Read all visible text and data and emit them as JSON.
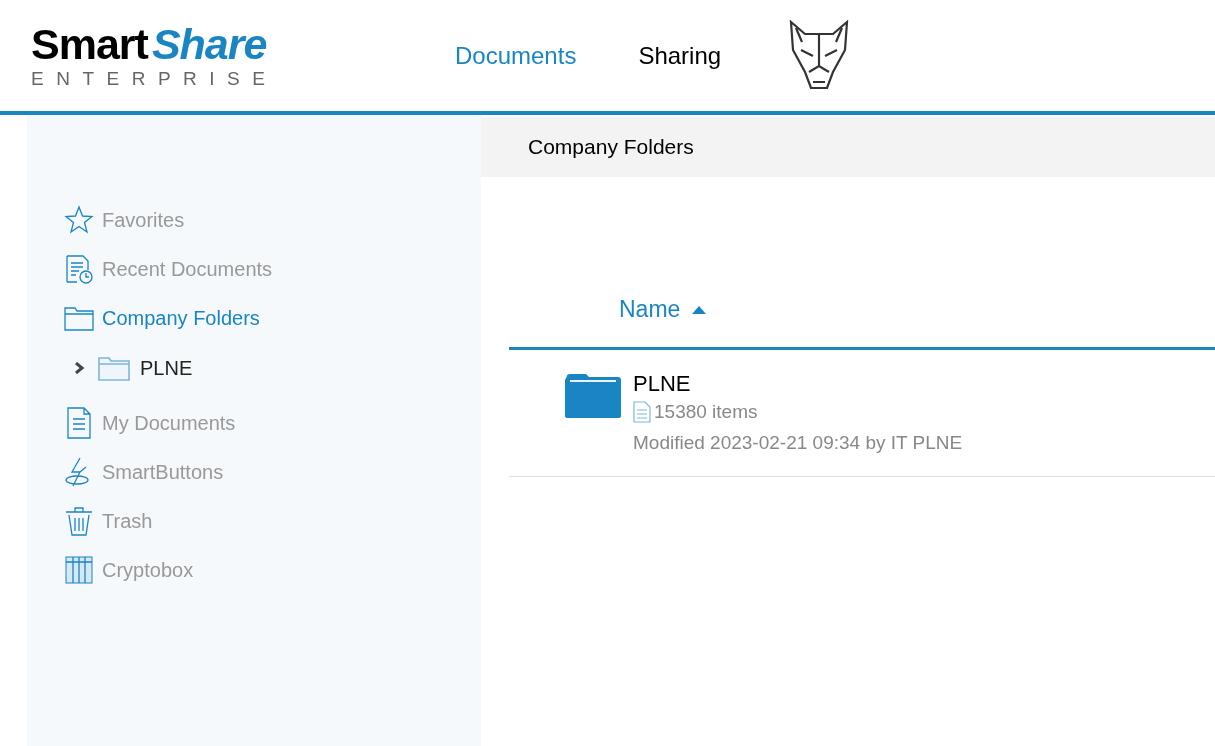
{
  "logo": {
    "word_1": "Smart",
    "word_2": "Share",
    "subtitle": "ENTERPRISE"
  },
  "nav": [
    {
      "label": "Documents",
      "selected": true
    },
    {
      "label": "Sharing",
      "selected": false
    }
  ],
  "sidebar": {
    "items": [
      {
        "kind": "star",
        "label": "Favorites",
        "selected": false
      },
      {
        "kind": "recent",
        "label": "Recent Documents",
        "selected": false
      },
      {
        "kind": "folder",
        "label": "Company Folders",
        "selected": true,
        "children": [
          {
            "label": "PLNE",
            "expanded": false
          }
        ]
      },
      {
        "kind": "document",
        "label": "My Documents",
        "selected": false
      },
      {
        "kind": "smartbuttons",
        "label": "SmartButtons",
        "selected": false
      },
      {
        "kind": "trash",
        "label": "Trash",
        "selected": false
      },
      {
        "kind": "cryptobox",
        "label": "Cryptobox",
        "selected": false
      }
    ]
  },
  "breadcrumb": "Company Folders",
  "table": {
    "columns": [
      {
        "label": "Name",
        "sort_ascending": true
      }
    ],
    "rows": [
      {
        "name": "PLNE",
        "count": "15380 items",
        "modified": "Modified 2023-02-21 09:34 by IT PLNE"
      }
    ]
  }
}
